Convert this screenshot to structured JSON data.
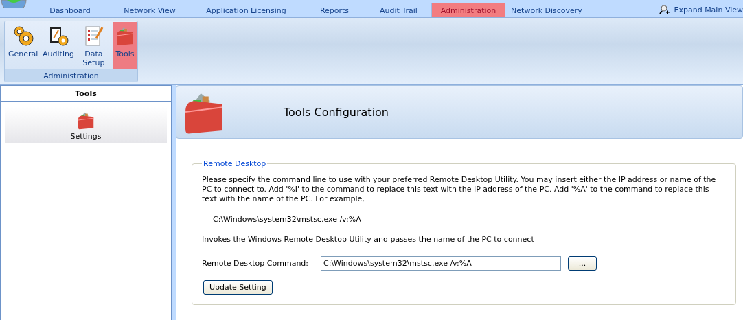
{
  "tabs": [
    {
      "label": "Dashboard",
      "selected": false
    },
    {
      "label": "Network View",
      "selected": false
    },
    {
      "label": "Application Licensing",
      "selected": false
    },
    {
      "label": "Reports",
      "selected": false
    },
    {
      "label": "Audit Trail",
      "selected": false
    },
    {
      "label": "Administration",
      "selected": true
    },
    {
      "label": "Network Discovery",
      "selected": false
    }
  ],
  "expand_button": {
    "label": "Expand Main View"
  },
  "ribbon": {
    "group_label": "Administration",
    "items": [
      {
        "label": "General",
        "kind": "gears",
        "selected": false
      },
      {
        "label": "Auditing",
        "kind": "clipboard",
        "selected": false
      },
      {
        "label": "Data Setup",
        "kind": "checklist",
        "selected": false
      },
      {
        "label": "Tools",
        "kind": "toolbox",
        "selected": true
      }
    ]
  },
  "sidebar": {
    "title": "Tools",
    "items": [
      {
        "label": "Settings",
        "selected": true
      }
    ]
  },
  "header": {
    "title": "Tools Configuration"
  },
  "group": {
    "legend": "Remote Desktop",
    "description": "Please specify the command line to use with your preferred Remote Desktop Utility.  You may insert either the IP address or name of the PC to connect to.  Add '%I' to the command to replace this text with the IP address of the PC.  Add '%A' to the command to replace this text with the name of the PC.  For example,",
    "example": "C:\\Windows\\system32\\mstsc.exe /v:%A",
    "note": "Invokes the Windows Remote Desktop Utility and passes the name of the PC to connect",
    "field_label": "Remote Desktop Command:",
    "field_value": "C:\\Windows\\system32\\mstsc.exe /v:%A",
    "browse_button": "...",
    "update_button": "Update Setting"
  }
}
